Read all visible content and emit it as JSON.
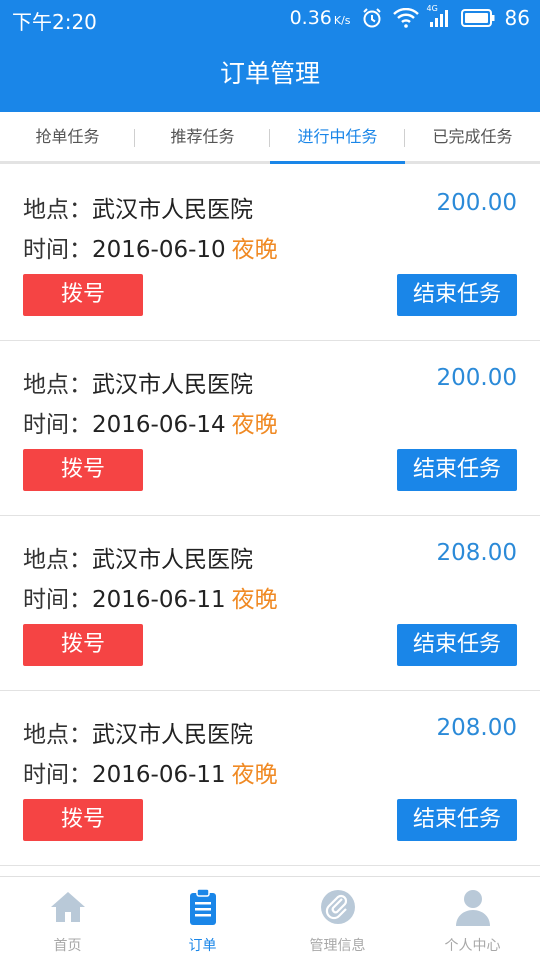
{
  "status_bar": {
    "time": "下午2:20",
    "speed": "0.36",
    "speed_unit": "K/s",
    "network": "4G",
    "battery": "86"
  },
  "header": {
    "title": "订单管理"
  },
  "tabs": [
    {
      "label": "抢单任务",
      "active": false
    },
    {
      "label": "推荐任务",
      "active": false
    },
    {
      "label": "进行中任务",
      "active": true
    },
    {
      "label": "已完成任务",
      "active": false
    }
  ],
  "orders": [
    {
      "location_label": "地点：",
      "location": "武汉市人民医院",
      "price": "200.00",
      "time_label": "时间：",
      "date": "2016-06-10",
      "period": "夜晚",
      "dial_label": "拨号",
      "end_label": "结束任务"
    },
    {
      "location_label": "地点：",
      "location": "武汉市人民医院",
      "price": "200.00",
      "time_label": "时间：",
      "date": "2016-06-14",
      "period": "夜晚",
      "dial_label": "拨号",
      "end_label": "结束任务"
    },
    {
      "location_label": "地点：",
      "location": "武汉市人民医院",
      "price": "208.00",
      "time_label": "时间：",
      "date": "2016-06-11",
      "period": "夜晚",
      "dial_label": "拨号",
      "end_label": "结束任务"
    },
    {
      "location_label": "地点：",
      "location": "武汉市人民医院",
      "price": "208.00",
      "time_label": "时间：",
      "date": "2016-06-11",
      "period": "夜晚",
      "dial_label": "拨号",
      "end_label": "结束任务"
    }
  ],
  "bottom_nav": [
    {
      "label": "首页",
      "icon": "home-icon",
      "active": false
    },
    {
      "label": "订单",
      "icon": "clipboard-icon",
      "active": true
    },
    {
      "label": "管理信息",
      "icon": "paperclip-icon",
      "active": false
    },
    {
      "label": "个人中心",
      "icon": "person-icon",
      "active": false
    }
  ],
  "colors": {
    "primary": "#1a86e8",
    "dial_button": "#f54444",
    "period_text": "#f08a24",
    "price_text": "#2b8ad8"
  }
}
